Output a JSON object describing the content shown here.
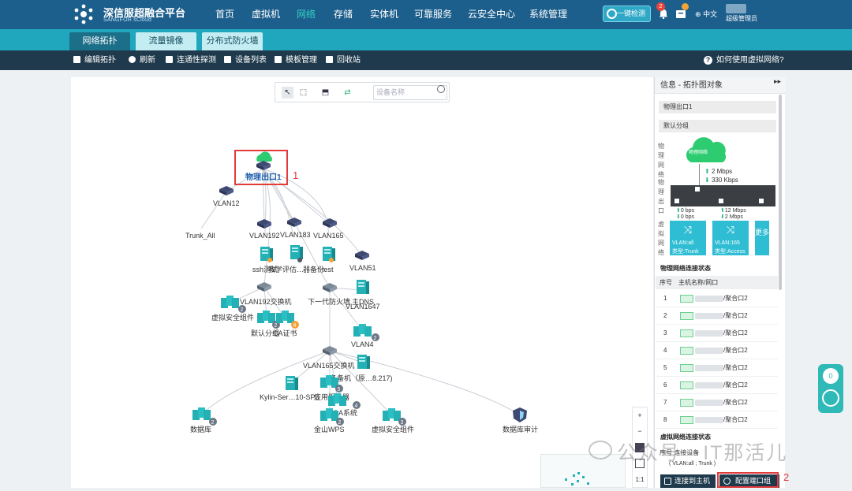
{
  "app": {
    "brand": "深信服超融合平台",
    "brand_sub": "SANGFOR sCloud"
  },
  "nav": {
    "items": [
      {
        "label": "首页"
      },
      {
        "label": "虚拟机"
      },
      {
        "label": "网络"
      },
      {
        "label": "存储"
      },
      {
        "label": "实体机"
      },
      {
        "label": "可靠服务"
      },
      {
        "label": "云安全中心"
      },
      {
        "label": "系统管理"
      }
    ],
    "active": "网络"
  },
  "header": {
    "onekey": "一键检测",
    "notify_count": "2",
    "lang": "中文",
    "user_role": "超级管理员"
  },
  "subtabs": [
    {
      "label": "网络拓扑"
    },
    {
      "label": "流量镜像"
    },
    {
      "label": "分布式防火墙"
    }
  ],
  "toolbar": {
    "items": [
      {
        "label": "编辑拓扑"
      },
      {
        "label": "刷新"
      },
      {
        "label": "连通性探测"
      },
      {
        "label": "设备列表"
      },
      {
        "label": "模板管理"
      },
      {
        "label": "回收站"
      }
    ],
    "help": "如何使用虚拟网络?"
  },
  "canvas": {
    "search_placeholder": "设备名称",
    "zoom": [
      "+",
      "−",
      "1:1"
    ]
  },
  "topology": {
    "labels": {
      "egress": "物理出口1",
      "vlan12": "VLAN12",
      "trunk_all": "Trunk_All",
      "vlan192": "VLAN192",
      "vlan183": "VLAN183",
      "vlan165": "VLAN165",
      "vlan51": "VLAN51",
      "ssh": "ssh测试",
      "teach": "教学评估…",
      "backup": "器备份",
      "test": "test",
      "vlan192sw": "VLAN192交换机",
      "ngfw": "下一代防火墙",
      "dns": "主DNS",
      "vlan1647": "VLAN1647",
      "vsec": "虚拟安全组件",
      "defgrp": "默认分组",
      "ca": "CA证书",
      "vlan4": "VLAN4",
      "defgrp2": "默认分组",
      "vlan165sw": "VLAN165交换机",
      "standby": "备备机（原…8.217)",
      "kylin": "Kylin-Ser…10-SP3",
      "app": "应用服务器",
      "oa": "OA系统",
      "db": "数据库",
      "wps": "金山WPS",
      "vsec2": "虚拟安全组件",
      "dbaudit": "数据库审计"
    },
    "badges": {
      "b1": "2",
      "b2": "2",
      "b3": "4",
      "b4": "2",
      "b5": "5",
      "b6": "4",
      "b7": "2",
      "b8": "2",
      "b9": "3"
    },
    "callout1": "1",
    "callout2": "2"
  },
  "panel": {
    "title": "信息 - 拓扑图对象",
    "name": "物理出口1",
    "group": "默认分组",
    "phys_net_label": "物理网络",
    "phys_port_label": "物理出口",
    "virt_net_label": "虚拟网络",
    "cloud": "物理网络",
    "up_speed": "2 Mbps",
    "down_speed": "330 Kbps",
    "port_a_up": "0 bps",
    "port_a_down": "0 bps",
    "port_b_up": "12 Mbps",
    "port_b_down": "2 Mbps",
    "vlan_tiles": [
      {
        "name": "VLAN:all",
        "type": "类型:Trunk"
      },
      {
        "name": "VLAN:165",
        "type": "类型:Access"
      }
    ],
    "more": "更多",
    "phys_conn_title": "物理网络连接状态",
    "table_head": {
      "num": "序号",
      "host": "主机名称/网口"
    },
    "rows": [
      {
        "num": "1",
        "port": "/聚合口2"
      },
      {
        "num": "2",
        "port": "/聚合口2"
      },
      {
        "num": "3",
        "port": "/聚合口2"
      },
      {
        "num": "4",
        "port": "/聚合口2"
      },
      {
        "num": "5",
        "port": "/聚合口2"
      },
      {
        "num": "6",
        "port": "/聚合口2"
      },
      {
        "num": "7",
        "port": "/聚合口2"
      },
      {
        "num": "8",
        "port": "/聚合口2"
      }
    ],
    "virt_conn_title": "虚拟网络连接状态",
    "vconn_head": "序号  连接设备",
    "vlan_trunk": "( VLAN:all ; Trunk )",
    "btn_connect": "连接到主机",
    "btn_config": "配置端口组"
  },
  "watermark": "公众号 · IT那活儿",
  "float_widget": "0"
}
